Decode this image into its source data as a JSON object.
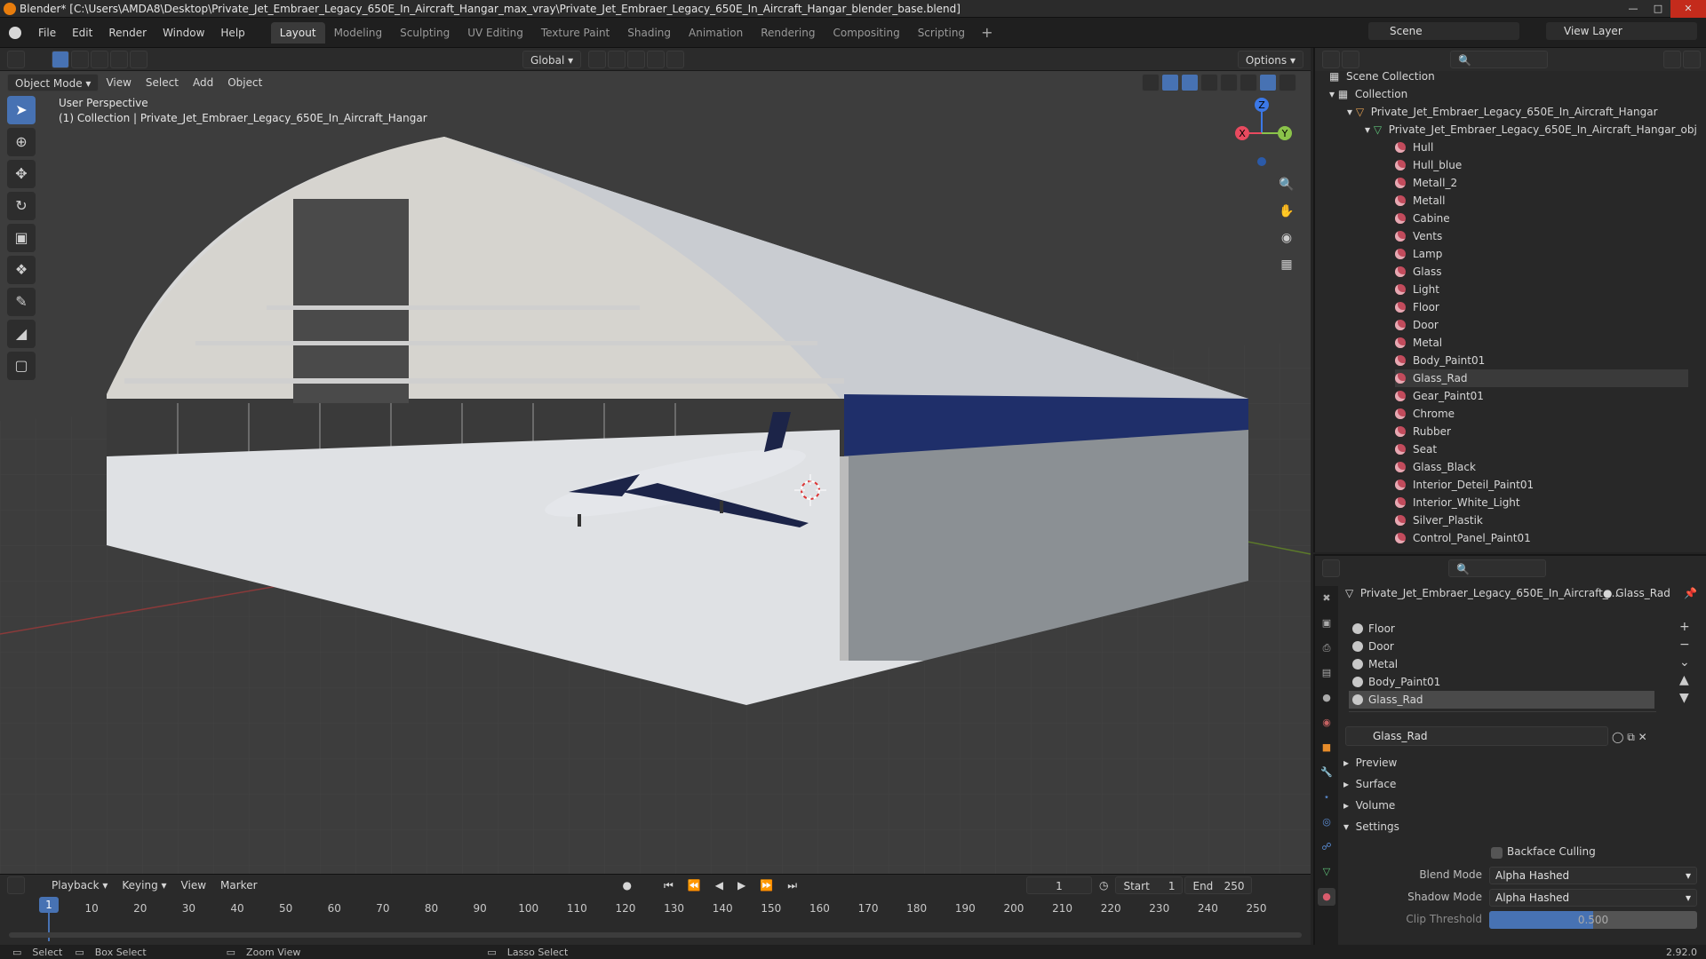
{
  "window": {
    "title": "Blender* [C:\\Users\\AMDA8\\Desktop\\Private_Jet_Embraer_Legacy_650E_In_Aircraft_Hangar_max_vray\\Private_Jet_Embraer_Legacy_650E_In_Aircraft_Hangar_blender_base.blend]"
  },
  "menu": {
    "file": "File",
    "edit": "Edit",
    "render": "Render",
    "window": "Window",
    "help": "Help"
  },
  "workspaces": [
    "Layout",
    "Modeling",
    "Sculpting",
    "UV Editing",
    "Texture Paint",
    "Shading",
    "Animation",
    "Rendering",
    "Compositing",
    "Scripting"
  ],
  "scene": {
    "label": "Scene",
    "view_layer": "View Layer"
  },
  "viewport": {
    "mode": "Object Mode",
    "view": "View",
    "select": "Select",
    "add": "Add",
    "object": "Object",
    "orientation": "Global",
    "options": "Options",
    "perspective": "User Perspective",
    "collection_info": "(1) Collection | Private_Jet_Embraer_Legacy_650E_In_Aircraft_Hangar",
    "gizmo": {
      "x": "X",
      "y": "Y",
      "z": "Z"
    }
  },
  "outliner": {
    "scene_collection": "Scene Collection",
    "collection": "Collection",
    "object": "Private_Jet_Embraer_Legacy_650E_In_Aircraft_Hangar",
    "mesh": "Private_Jet_Embraer_Legacy_650E_In_Aircraft_Hangar_obj",
    "materials": [
      "Hull",
      "Hull_blue",
      "Metall_2",
      "Metall",
      "Cabine",
      "Vents",
      "Lamp",
      "Glass",
      "Light",
      "Floor",
      "Door",
      "Metal",
      "Body_Paint01",
      "Glass_Rad",
      "Gear_Paint01",
      "Chrome",
      "Rubber",
      "Seat",
      "Glass_Black",
      "Interior_Deteil_Paint01",
      "Interior_White_Light",
      "Silver_Plastik",
      "Control_Panel_Paint01"
    ],
    "selected": "Glass_Rad"
  },
  "properties": {
    "object_name": "Private_Jet_Embraer_Legacy_650E_In_Aircraft_...",
    "material_name": "Glass_Rad",
    "slots": [
      "Floor",
      "Door",
      "Metal",
      "Body_Paint01",
      "Glass_Rad"
    ],
    "active_material": "Glass_Rad",
    "panels": {
      "preview": "Preview",
      "surface": "Surface",
      "volume": "Volume",
      "settings": "Settings"
    },
    "backface_culling": "Backface Culling",
    "blend_mode_label": "Blend Mode",
    "blend_mode": "Alpha Hashed",
    "shadow_mode_label": "Shadow Mode",
    "shadow_mode": "Alpha Hashed",
    "clip_threshold_label": "Clip Threshold",
    "clip_threshold": "0.500",
    "clip_fraction": 0.5
  },
  "timeline": {
    "playback": "Playback",
    "keying": "Keying",
    "view": "View",
    "marker": "Marker",
    "current_frame": "1",
    "start_label": "Start",
    "start": "1",
    "end_label": "End",
    "end": "250",
    "ticks": [
      "1",
      "10",
      "20",
      "30",
      "40",
      "50",
      "60",
      "70",
      "80",
      "90",
      "100",
      "110",
      "120",
      "130",
      "140",
      "150",
      "160",
      "170",
      "180",
      "190",
      "200",
      "210",
      "220",
      "230",
      "240",
      "250"
    ]
  },
  "status": {
    "select": "Select",
    "box_select": "Box Select",
    "zoom_view": "Zoom View",
    "lasso_select": "Lasso Select",
    "version": "2.92.0"
  }
}
